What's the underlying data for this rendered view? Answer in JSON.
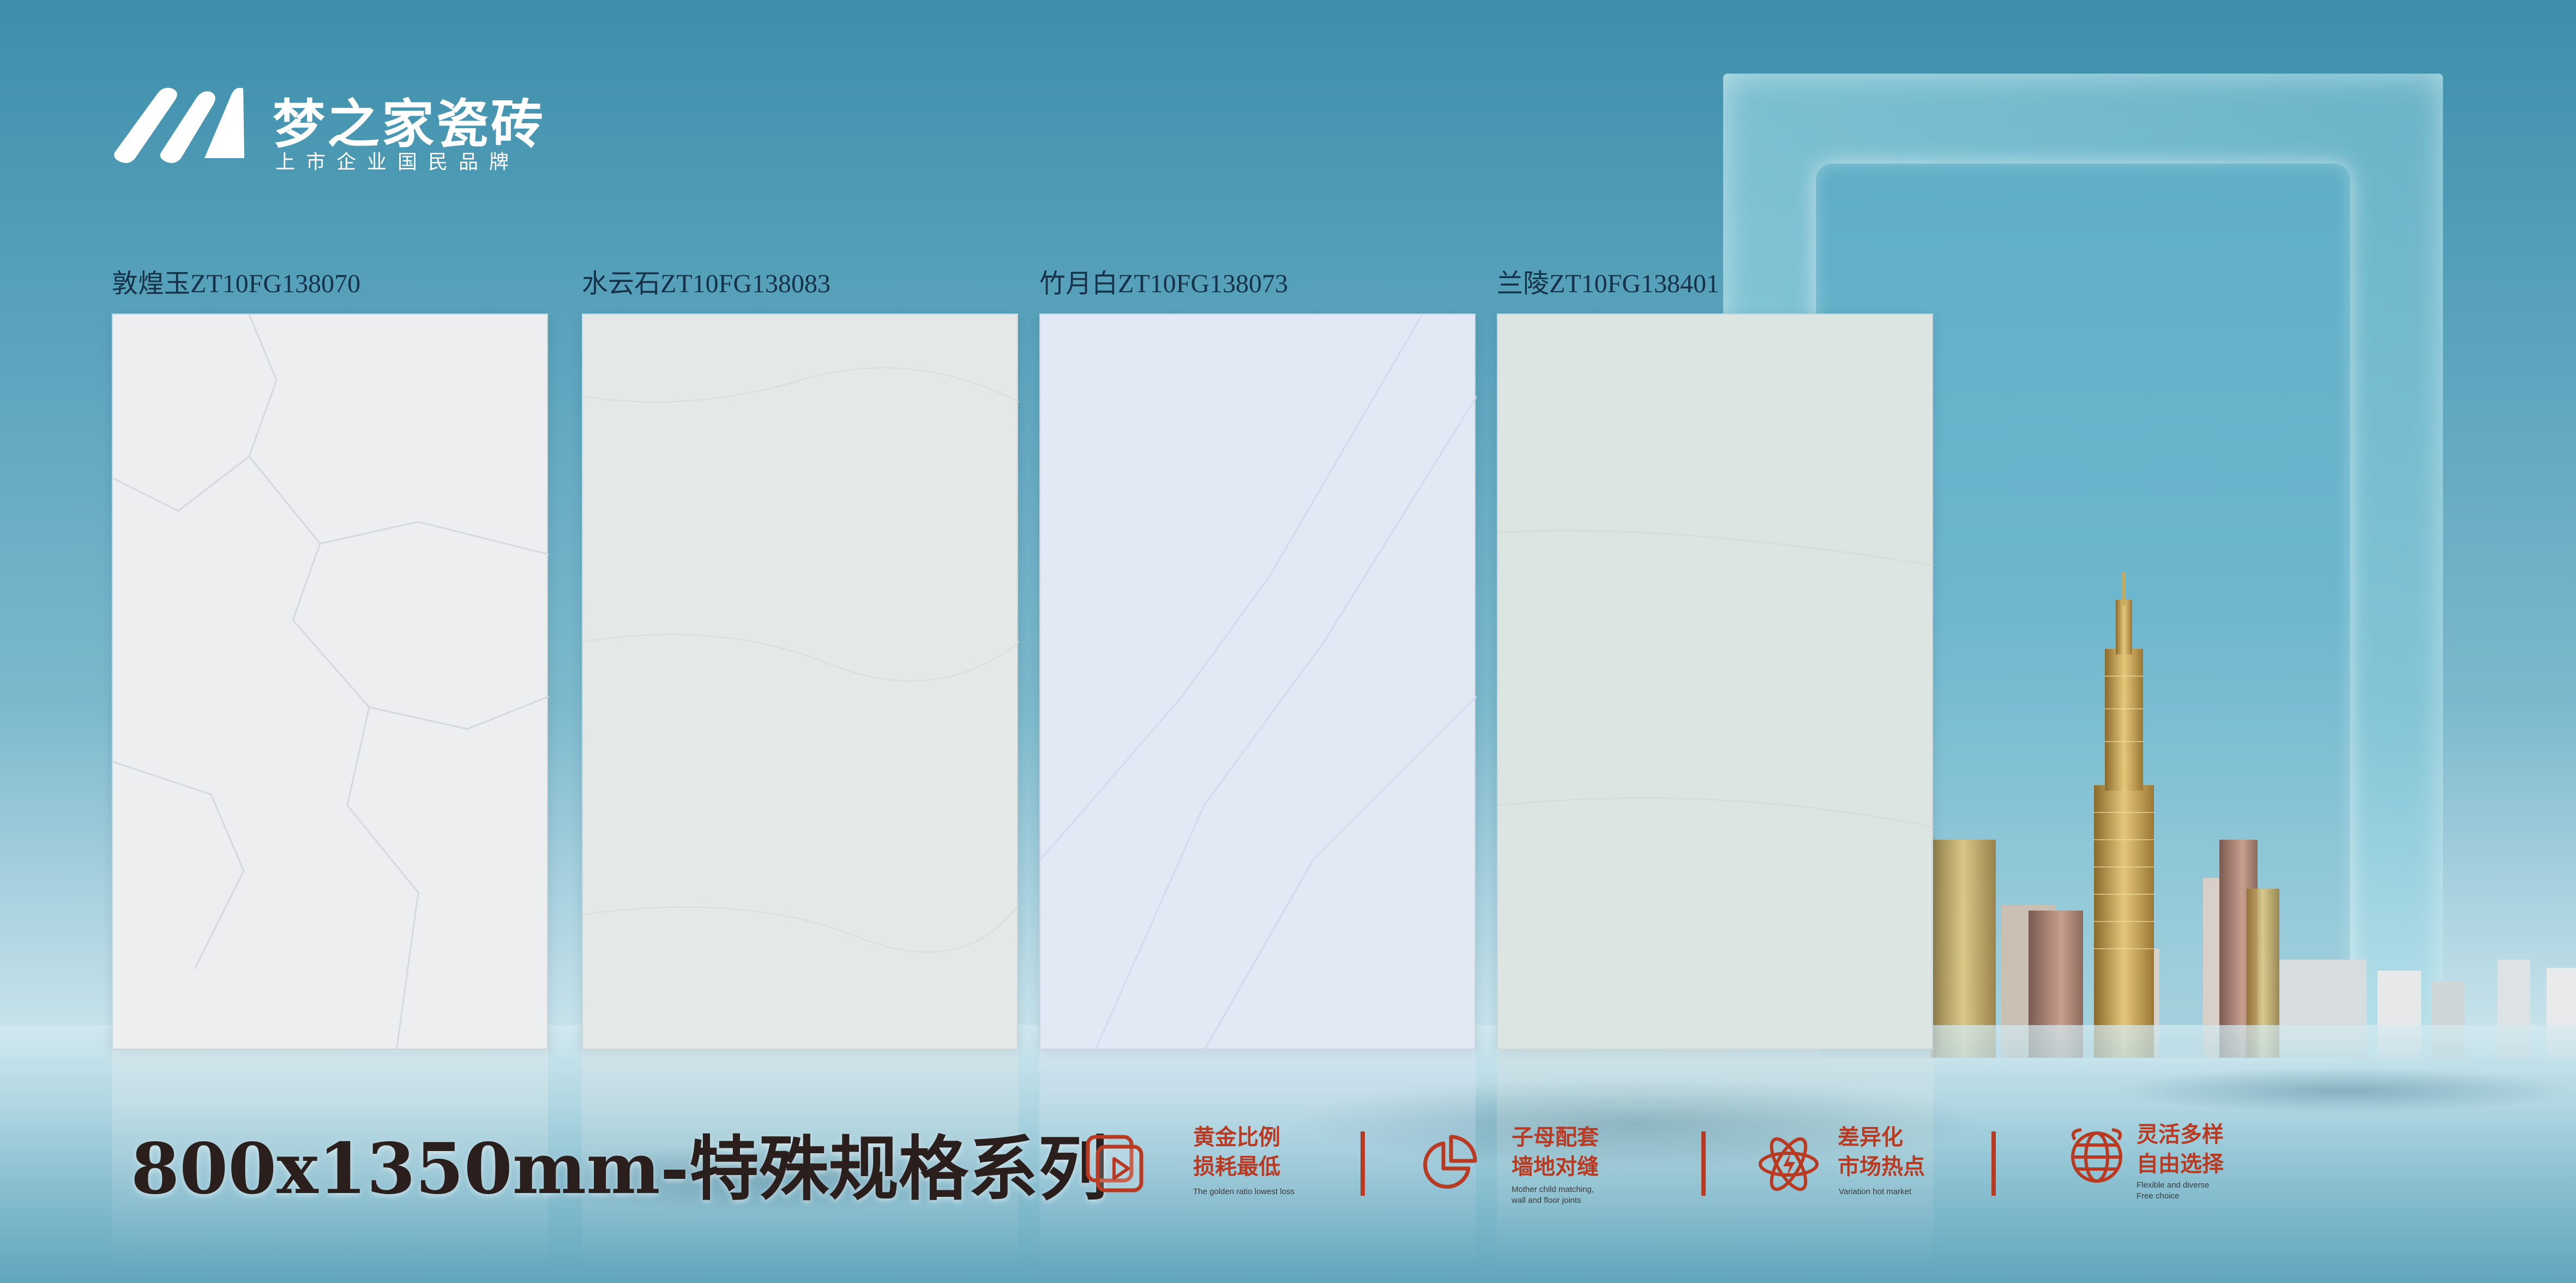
{
  "brand": {
    "name": "梦之家瓷砖",
    "tagline": "上市企业国民品牌"
  },
  "tiles": [
    {
      "label": "敦煌玉ZT10FG138070",
      "color": "#eceef0"
    },
    {
      "label": "水云石ZT10FG138083",
      "color": "#e4e8e6"
    },
    {
      "label": "竹月白ZT10FG138073",
      "color": "#e3e8f5"
    },
    {
      "label": "兰陵ZT10FG138401",
      "color": "#dce5e2"
    }
  ],
  "series_title": "800x1350mm-特殊规格系列",
  "features": [
    {
      "line1": "黄金比例",
      "line2": "损耗最低",
      "en": [
        "The golden ratio lowest loss"
      ],
      "icon": "play-layers-icon"
    },
    {
      "line1": "子母配套",
      "line2": "墙地对缝",
      "en": [
        "Mother child matching,",
        "wall and floor joints"
      ],
      "icon": "pie-chart-icon"
    },
    {
      "line1": "差异化",
      "line2": "市场热点",
      "en": [
        "Variation hot market"
      ],
      "icon": "atom-icon"
    },
    {
      "line1": "灵活多样",
      "line2": "自由选择",
      "en": [
        "Flexible and diverse",
        "Free choice"
      ],
      "icon": "globe-icon"
    }
  ],
  "colors": {
    "accent": "#b83a22",
    "sky": "#4b97b1"
  }
}
